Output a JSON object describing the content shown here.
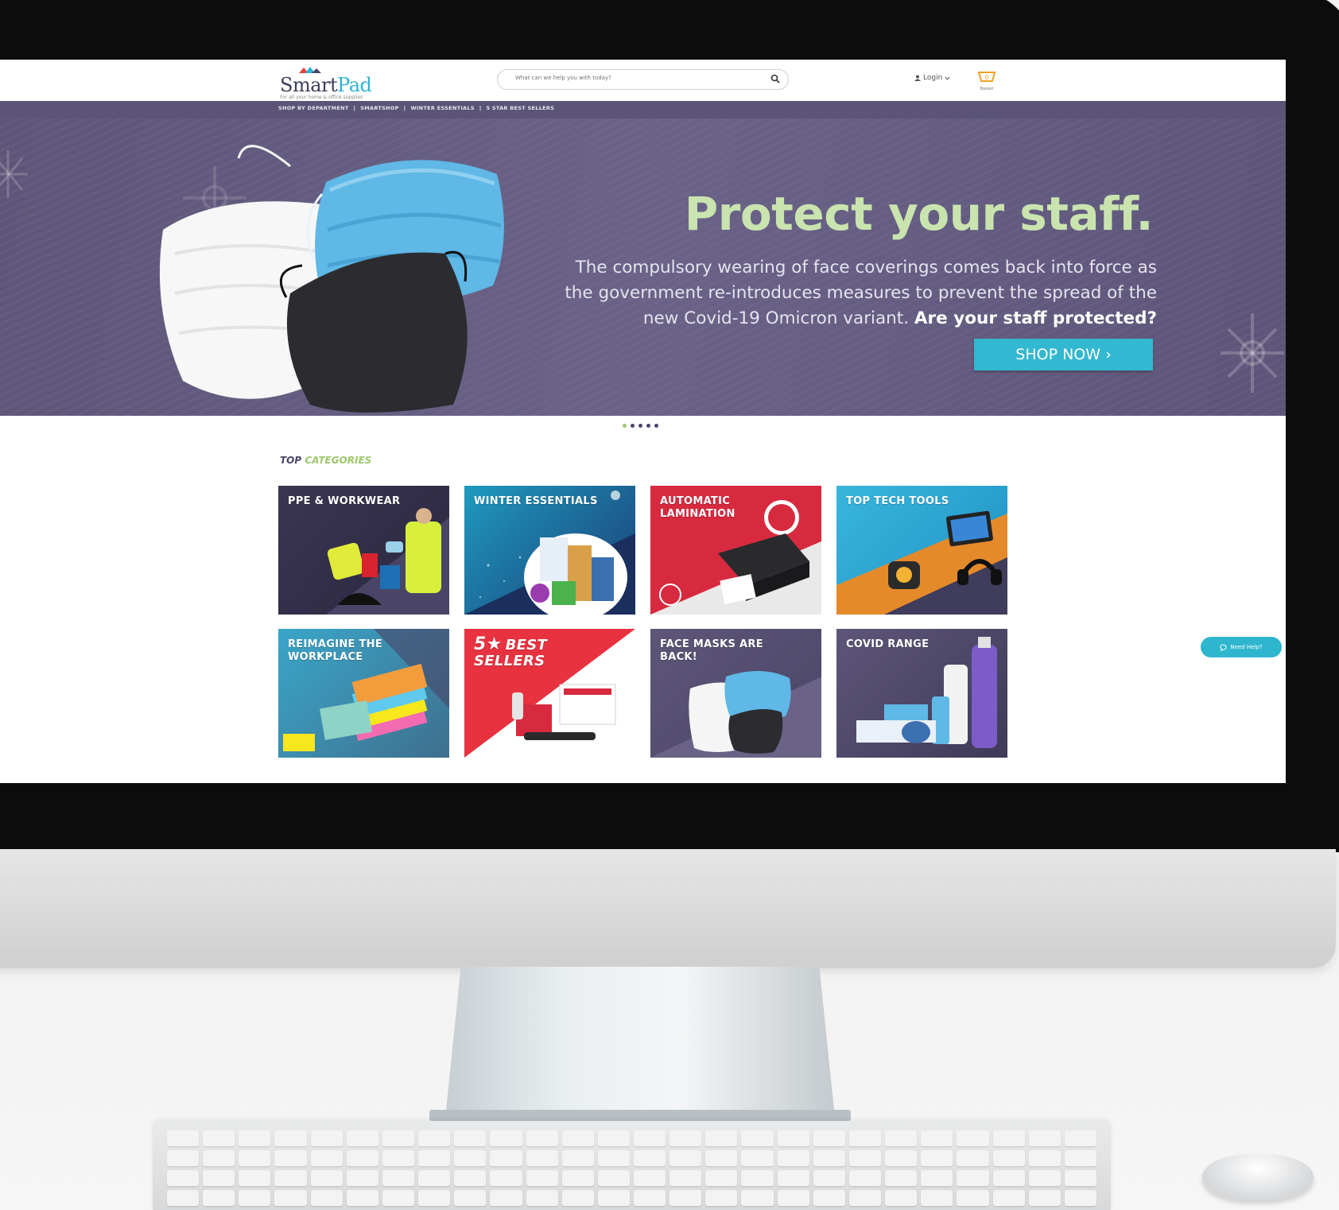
{
  "header": {
    "logo_text_a": "Smart",
    "logo_text_b": "Pad",
    "logo_tagline": "For all your home & office supplies",
    "search_placeholder": "What can we help you with today?",
    "login_label": "Login",
    "basket_label": "Basket",
    "basket_count": "0"
  },
  "nav": {
    "items": [
      "SHOP BY DEPARTMENT",
      "SMARTSHOP",
      "WINTER ESSENTIALS",
      "5 STAR BEST SELLERS"
    ]
  },
  "hero": {
    "title": "Protect your staff.",
    "body_line1": "The compulsory wearing of face coverings comes back into force as",
    "body_line2": "the government re-introduces measures to prevent the spread of the",
    "body_line3": "new Covid-19 Omicron variant.",
    "body_emphasis": "Are your staff protected?",
    "cta_label": "SHOP NOW ›",
    "slides_total": 5,
    "slide_active": 1
  },
  "categories": {
    "title_a": "TOP",
    "title_b": "CATEGORIES",
    "tiles": [
      {
        "label": "PPE & WORKWEAR"
      },
      {
        "label": "WINTER ESSENTIALS"
      },
      {
        "label": "AUTOMATIC LAMINATION"
      },
      {
        "label": "TOP TECH TOOLS"
      },
      {
        "label": "REIMAGINE THE WORKPLACE"
      },
      {
        "label": "BEST SELLERS",
        "badge": "5★"
      },
      {
        "label": "FACE MASKS ARE BACK!"
      },
      {
        "label": "COVID RANGE"
      }
    ]
  },
  "help_label": "Need Help?",
  "colors": {
    "brand_purple": "#5b5477",
    "accent_green": "#c9e4ae",
    "accent_cyan": "#32b8d0"
  }
}
